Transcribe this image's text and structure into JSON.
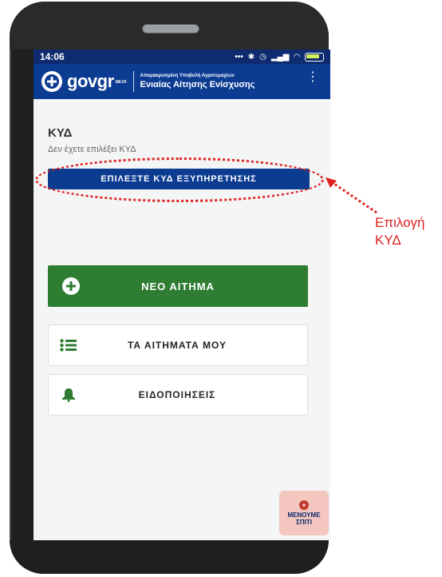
{
  "status": {
    "time": "14:06"
  },
  "header": {
    "brand_main": "gov",
    "brand_accent": "gr",
    "beta": "BETA",
    "subtitle": "Απομακρυσμένη Υποβολή Αγροτεμαχίων",
    "title": "Ενιαίας Αίτησης Ενίσχυσης"
  },
  "kyd": {
    "title": "ΚΥΔ",
    "subtitle": "Δεν έχετε επιλέξει ΚΥΔ",
    "button_label": "ΕΠΙΛΕΞΤΕ ΚΥΔ ΕΞΥΠΗΡΕΤΗΣΗΣ"
  },
  "actions": {
    "new_request": "ΝΕΟ ΑΙΤΗΜΑ",
    "my_requests": "ΤΑ ΑΙΤΗΜΑΤΑ ΜΟΥ",
    "notifications": "ΕΙΔΟΠΟΙΗΣΕΙΣ"
  },
  "sticker": {
    "line1": "ΜΕΝΟΥΜΕ",
    "line2": "ΣΠΙΤΙ"
  },
  "annotation": {
    "line1": "Επιλογή",
    "line2": "ΚΥΔ"
  },
  "colors": {
    "primary": "#0c3c92",
    "success": "#2e7d32",
    "annotation": "#e02020"
  },
  "icons": {
    "logo": "greek-cross-icon",
    "plus": "plus-circle-icon",
    "list": "list-icon",
    "bell": "bell-icon"
  }
}
